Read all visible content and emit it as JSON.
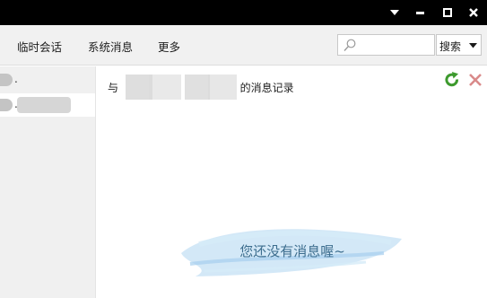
{
  "window": {
    "controls": [
      "menu-icon",
      "minimize-icon",
      "maximize-icon",
      "close-icon"
    ]
  },
  "toolbar": {
    "temp_session": "临时会话",
    "system_messages": "系统消息",
    "more": "更多",
    "search_placeholder": "",
    "search_button": "搜索"
  },
  "sidebar": {
    "contacts": [
      {
        "label": "."
      },
      {
        "label": "."
      }
    ]
  },
  "main": {
    "header_prefix": "与",
    "header_suffix": "的消息记录",
    "empty_message": "您还没有消息喔~"
  },
  "colors": {
    "titlebar": "#000000",
    "toolbar_bg": "#f1f1f1",
    "sidebar_bg": "#f0f0f0",
    "refresh_green": "#3d9a2e",
    "delete_red": "#d98a8a",
    "empty_text": "#3c6d8e",
    "empty_brush": "#bcdcf2"
  }
}
